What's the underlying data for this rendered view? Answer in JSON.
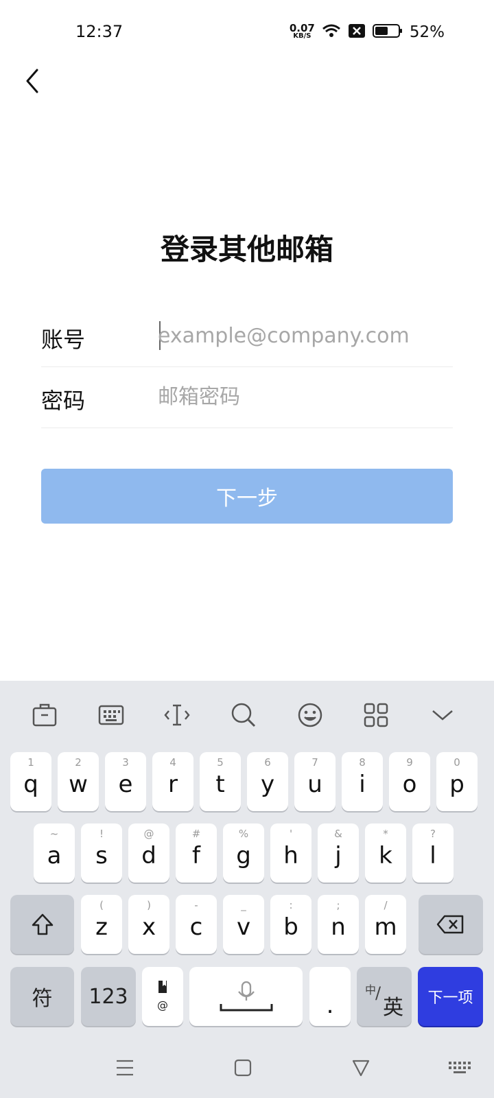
{
  "status_bar": {
    "time": "12:37",
    "net_speed_value": "0.07",
    "net_speed_unit": "KB/S",
    "battery_percent": "52%"
  },
  "page": {
    "title": "登录其他邮箱",
    "account_label": "账号",
    "account_placeholder": "example@company.com",
    "password_label": "密码",
    "password_placeholder": "邮箱密码",
    "next_button": "下一步"
  },
  "keyboard": {
    "row1": [
      {
        "key": "q",
        "hint": "1"
      },
      {
        "key": "w",
        "hint": "2"
      },
      {
        "key": "e",
        "hint": "3"
      },
      {
        "key": "r",
        "hint": "4"
      },
      {
        "key": "t",
        "hint": "5"
      },
      {
        "key": "y",
        "hint": "6"
      },
      {
        "key": "u",
        "hint": "7"
      },
      {
        "key": "i",
        "hint": "8"
      },
      {
        "key": "o",
        "hint": "9"
      },
      {
        "key": "p",
        "hint": "0"
      }
    ],
    "row2": [
      {
        "key": "a",
        "hint": "~"
      },
      {
        "key": "s",
        "hint": "!"
      },
      {
        "key": "d",
        "hint": "@"
      },
      {
        "key": "f",
        "hint": "#"
      },
      {
        "key": "g",
        "hint": "%"
      },
      {
        "key": "h",
        "hint": "'"
      },
      {
        "key": "j",
        "hint": "&"
      },
      {
        "key": "k",
        "hint": "*"
      },
      {
        "key": "l",
        "hint": "?"
      }
    ],
    "row3": [
      {
        "key": "z",
        "hint": "("
      },
      {
        "key": "x",
        "hint": ")"
      },
      {
        "key": "c",
        "hint": "-"
      },
      {
        "key": "v",
        "hint": "_"
      },
      {
        "key": "b",
        "hint": ":"
      },
      {
        "key": "n",
        "hint": ";"
      },
      {
        "key": "m",
        "hint": "/"
      }
    ],
    "symbols_key": "符",
    "numbers_key": "123",
    "at_key": "@",
    "period_key": ".",
    "lang_small": "中",
    "lang_slash": "/",
    "lang_big": "英",
    "enter_key": "下一项"
  },
  "icons": {
    "toolbar": [
      "clipboard-icon",
      "keyboard-icon",
      "cursor-icon",
      "search-icon",
      "emoji-icon",
      "apps-grid-icon",
      "chevron-down-icon"
    ],
    "nav": [
      "menu-icon",
      "home-icon",
      "back-icon",
      "keyboard-switch-icon"
    ]
  },
  "colors": {
    "accent": "#2f3de0",
    "button_disabled": "#8fb9ee",
    "keyboard_bg": "#e6e8ec"
  }
}
